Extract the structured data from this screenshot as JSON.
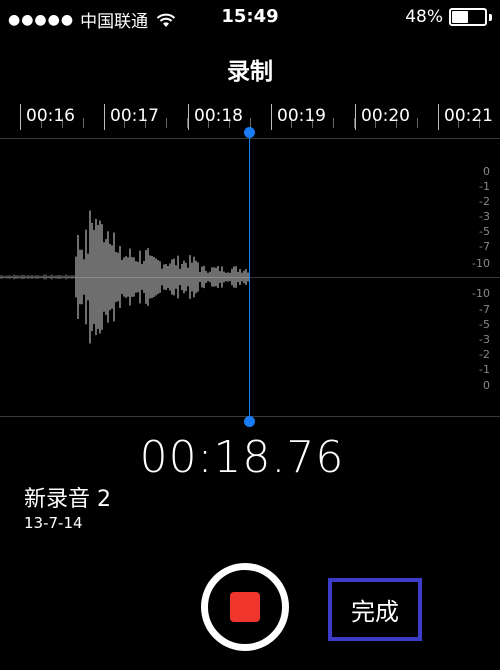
{
  "status_bar": {
    "signal_dots": "●●●●●",
    "carrier": "中国联通",
    "time": "15:49",
    "battery_percent": "48%",
    "battery_level": 0.48
  },
  "nav": {
    "title": "录制"
  },
  "timeline": {
    "labels": [
      "00:16",
      "00:17",
      "00:18",
      "00:19",
      "00:20",
      "00:21"
    ]
  },
  "meter": {
    "top_scale": [
      "0",
      "-1",
      "-2",
      "-3",
      "-5",
      "-7",
      "-10"
    ],
    "bottom_scale": [
      "-10",
      "-7",
      "-5",
      "-3",
      "-2",
      "-1",
      "0"
    ]
  },
  "elapsed_time": "00:18.76",
  "recording": {
    "name": "新录音 2",
    "date": "13-7-14"
  },
  "controls": {
    "done_label": "完成"
  },
  "colors": {
    "playhead": "#1a7cf5",
    "stop": "#f0352d",
    "done_highlight": "#3c3cc8"
  }
}
